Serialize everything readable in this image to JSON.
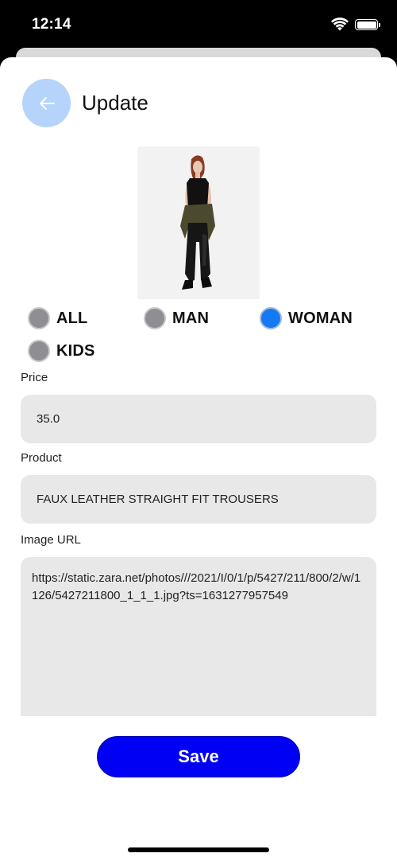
{
  "status_bar": {
    "time": "12:14",
    "wifi_icon": "wifi-icon",
    "battery_icon": "battery-icon"
  },
  "header": {
    "back_icon": "arrow-left-icon",
    "title": "Update"
  },
  "product_image": {
    "description_icon": "product-photo"
  },
  "categories": {
    "options": [
      {
        "label": "ALL",
        "selected": false
      },
      {
        "label": "MAN",
        "selected": false
      },
      {
        "label": "WOMAN",
        "selected": true
      },
      {
        "label": "KIDS",
        "selected": false
      }
    ]
  },
  "fields": {
    "price_label": "Price",
    "price_value": "35.0",
    "product_label": "Product",
    "product_value": "FAUX LEATHER STRAIGHT FIT TROUSERS",
    "image_url_label": "Image URL",
    "image_url_value": "https://static.zara.net/photos///2021/I/0/1/p/5427/211/800/2/w/1126/5427211800_1_1_1.jpg?ts=1631277957549"
  },
  "actions": {
    "save_label": "Save"
  },
  "colors": {
    "accent": "#0000f5",
    "radio_selected": "#1479f5",
    "back_button": "#b5d3fb",
    "field_bg": "#e8e8e8"
  }
}
